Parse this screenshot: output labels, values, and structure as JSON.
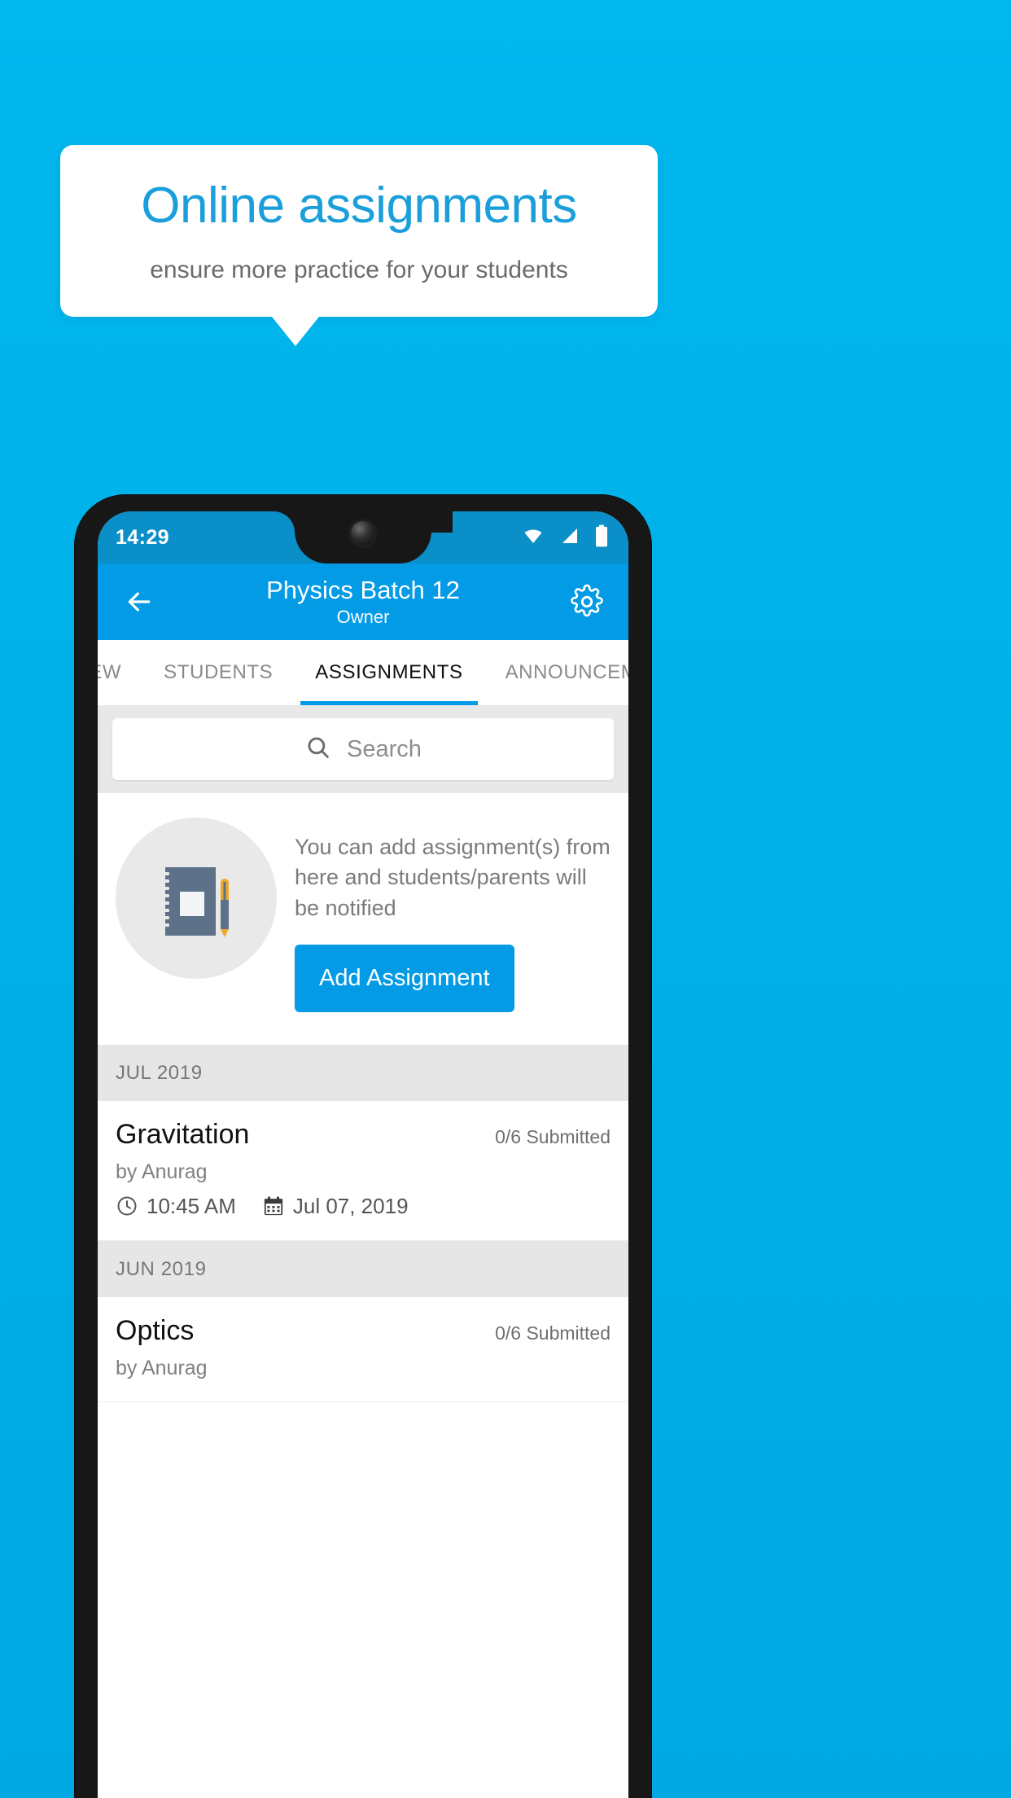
{
  "promo": {
    "title": "Online assignments",
    "subtitle": "ensure more practice for your students",
    "title_color": "#1b9fdb",
    "background_color": "#00b0e8"
  },
  "phone": {
    "status_bar": {
      "time": "14:29",
      "icons": [
        "wifi-icon",
        "cellular-signal-icon",
        "battery-icon"
      ]
    },
    "app_bar": {
      "back_icon": "arrow-left-icon",
      "title": "Physics Batch 12",
      "subtitle": "Owner",
      "settings_icon": "gear-icon",
      "background_color": "#039be5"
    },
    "tabs": [
      {
        "label": "IEW",
        "active": false
      },
      {
        "label": "STUDENTS",
        "active": false
      },
      {
        "label": "ASSIGNMENTS",
        "active": true
      },
      {
        "label": "ANNOUNCEM",
        "active": false
      }
    ],
    "search": {
      "icon": "search-icon",
      "placeholder": "Search",
      "value": ""
    },
    "empty_state": {
      "illustration": "notebook-and-pen-icon",
      "message": "You can add assignment(s) from here and students/parents will be notified",
      "button_label": "Add Assignment"
    },
    "groups": [
      {
        "month": "JUL 2019",
        "items": [
          {
            "title": "Gravitation",
            "submitted": "0/6 Submitted",
            "author": "by Anurag",
            "time": "10:45 AM",
            "date": "Jul 07, 2019",
            "clock_icon": "clock-icon",
            "calendar_icon": "calendar-icon"
          }
        ]
      },
      {
        "month": "JUN 2019",
        "items": [
          {
            "title": "Optics",
            "submitted": "0/6 Submitted",
            "author": "by Anurag",
            "time": "",
            "date": "",
            "clock_icon": "clock-icon",
            "calendar_icon": "calendar-icon"
          }
        ]
      }
    ]
  }
}
